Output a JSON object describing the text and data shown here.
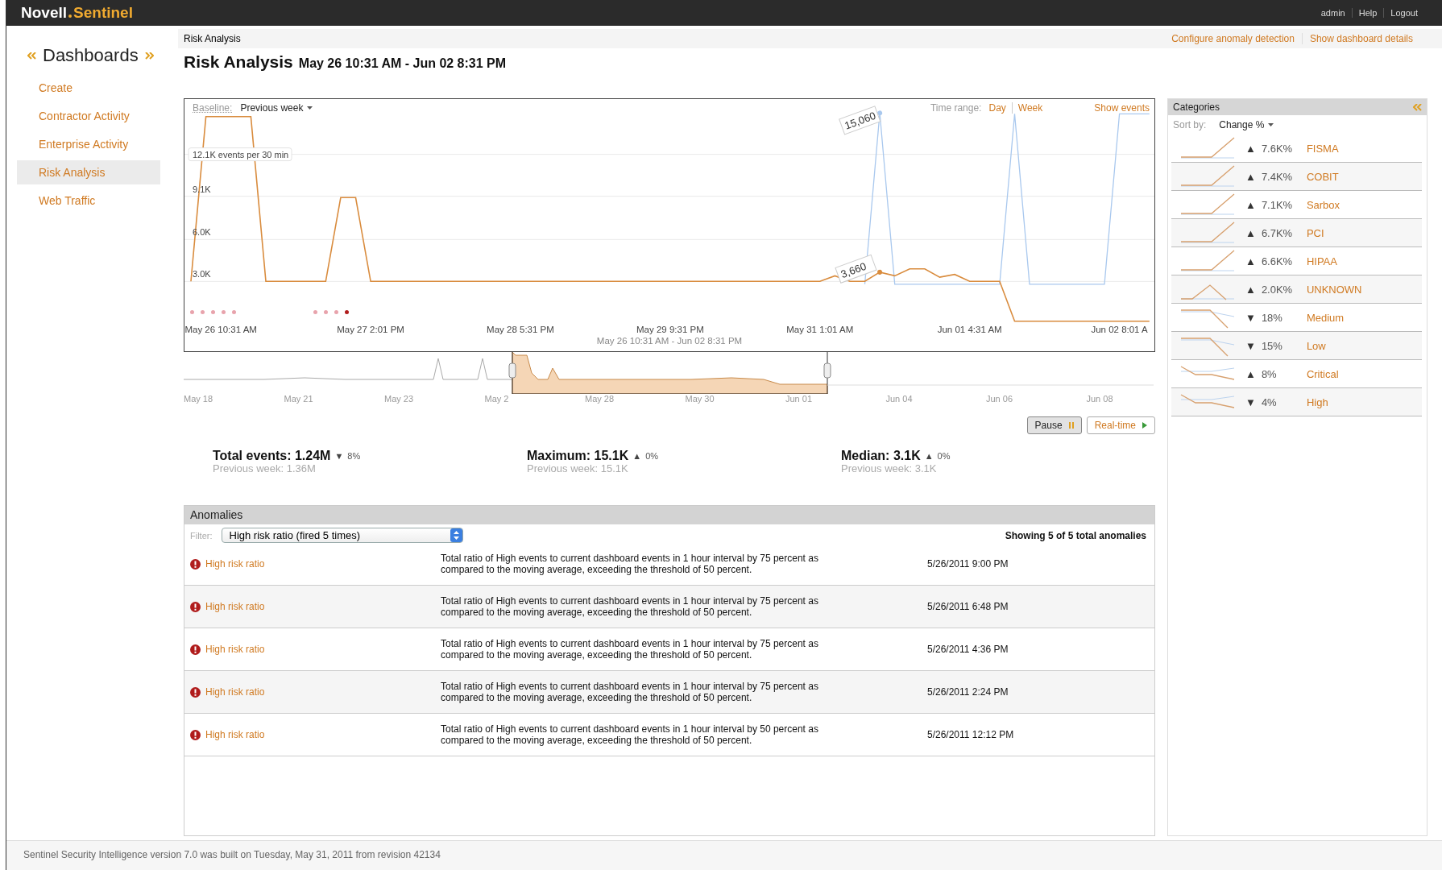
{
  "header": {
    "brand": "Novell",
    "product": "Sentinel",
    "links": [
      "admin",
      "Help",
      "Logout"
    ]
  },
  "sidebar": {
    "title": "Dashboards",
    "items": [
      {
        "label": "Create",
        "selected": false
      },
      {
        "label": "Contractor Activity",
        "selected": false
      },
      {
        "label": "Enterprise Activity",
        "selected": false
      },
      {
        "label": "Risk Analysis",
        "selected": true
      },
      {
        "label": "Web Traffic",
        "selected": false
      }
    ]
  },
  "breadcrumb": "Risk Analysis",
  "actions": [
    "Configure anomaly detection",
    "Show dashboard details"
  ],
  "page_title": {
    "title": "Risk Analysis",
    "range": "May 26 10:31 AM - Jun 02 8:31 PM"
  },
  "chart": {
    "baseline_label": "Baseline:",
    "baseline": "Previous week",
    "time_range_label": "Time range:",
    "time_ranges": [
      "Day",
      "Week"
    ],
    "show_events": "Show events",
    "chart_data": {
      "type": "line",
      "xlabel": "May 26 10:31 AM - Jun 02 8:31 PM",
      "categories": [
        null,
        null,
        "May 26 10:31 AM",
        null,
        null,
        null,
        null,
        null,
        null,
        null,
        null,
        null,
        "May 27 2:01 PM",
        null,
        null,
        null,
        null,
        null,
        null,
        null,
        null,
        null,
        "May 28 5:31 PM",
        null,
        null,
        null,
        null,
        null,
        null,
        null,
        null,
        null,
        "May 29 9:31 PM",
        null,
        null,
        null,
        null,
        null,
        null,
        null,
        null,
        null,
        "May 31 1:01 AM",
        null,
        null,
        null,
        null,
        null,
        null,
        null,
        null,
        null,
        "Jun 01 4:31 AM",
        null,
        null,
        null,
        null,
        null,
        null,
        null,
        null,
        null,
        "Jun 02 8:01 A",
        null,
        null
      ],
      "grid": true,
      "ylim": [
        -2000,
        16000
      ],
      "series": [
        {
          "color": "#a9c8ee",
          "values": [
            null,
            null,
            null,
            null,
            null,
            null,
            null,
            null,
            null,
            null,
            null,
            null,
            null,
            null,
            null,
            null,
            null,
            null,
            null,
            null,
            null,
            null,
            null,
            null,
            null,
            null,
            null,
            null,
            null,
            null,
            null,
            null,
            null,
            null,
            null,
            null,
            null,
            null,
            null,
            null,
            null,
            null,
            null,
            null,
            null,
            2800,
            15060,
            2800,
            2800,
            2800,
            2800,
            2800,
            2800,
            2800,
            2800,
            15000,
            2800,
            2800,
            2800,
            2800,
            2800,
            2800,
            15000,
            15000,
            15000
          ]
        },
        {
          "color": "#d98c3e",
          "values": [
            3000,
            14800,
            14800,
            14800,
            14800,
            3000,
            3000,
            3000,
            3000,
            3000,
            9000,
            9000,
            3000,
            3000,
            3000,
            3000,
            3000,
            3000,
            3000,
            3000,
            3000,
            3000,
            3000,
            3000,
            3000,
            3000,
            3000,
            3000,
            3000,
            3000,
            3000,
            3000,
            3000,
            3000,
            3000,
            3000,
            3000,
            3000,
            3000,
            3000,
            3000,
            3000,
            3000,
            3400,
            3000,
            3000,
            3660,
            3400,
            3900,
            3900,
            3300,
            3500,
            3000,
            3000,
            3000,
            150,
            150,
            150,
            150,
            150,
            150,
            150,
            150,
            150,
            150
          ]
        }
      ],
      "yticks": [
        {
          "value": 3000,
          "label": "3.0K"
        },
        {
          "value": 6000,
          "label": "6.0K"
        },
        {
          "value": 9100,
          "label": "9.1K"
        },
        {
          "value": 12100,
          "label": "12.1K events per 30 min"
        }
      ],
      "annotations": [
        "15,060",
        "3,660"
      ]
    },
    "event_marker_groups": [
      [
        {
          "color": "#e8a3ac"
        },
        {
          "color": "#e8a3ac"
        },
        {
          "color": "#e8a3ac"
        },
        {
          "color": "#e8a3ac"
        },
        {
          "color": "#e8a3ac"
        }
      ],
      [
        {
          "color": "#e8a3ac"
        },
        {
          "color": "#e8a3ac"
        },
        {
          "color": "#e8a3ac"
        },
        {
          "color": "#b01c1c"
        }
      ]
    ]
  },
  "navigator": {
    "labels": [
      "May 18",
      "May 21",
      "May 23",
      "May 2",
      "May 28",
      "May 30",
      "Jun 01",
      "Jun 04",
      "Jun 06",
      "Jun 08"
    ]
  },
  "playback": [
    {
      "label": "Pause",
      "kind": "pause",
      "selected": true
    },
    {
      "label": "Real-time",
      "kind": "play",
      "selected": false
    }
  ],
  "stats": [
    {
      "label": "Total events: 1.24M",
      "arrow": "▼",
      "change": "8%",
      "previous": "Previous week: 1.36M"
    },
    {
      "label": "Maximum: 15.1K",
      "arrow": "▲",
      "change": "0%",
      "previous": "Previous week: 15.1K"
    },
    {
      "label": "Median: 3.1K",
      "arrow": "▲",
      "change": "0%",
      "previous": "Previous week: 3.1K"
    }
  ],
  "anomalies": {
    "title": "Anomalies",
    "filter_label": "Filter:",
    "filter": "High risk ratio (fired 5 times)",
    "summary": "Showing 5 of 5 total anomalies",
    "rows": [
      {
        "name": "High risk ratio",
        "description": "Total ratio of High events to current dashboard events in 1 hour interval by 75 percent as compared to the moving average, exceeding the threshold of 50 percent.",
        "time": "5/26/2011 9:00 PM"
      },
      {
        "name": "High risk ratio",
        "description": "Total ratio of High events to current dashboard events in 1 hour interval by 75 percent as compared to the moving average, exceeding the threshold of 50 percent.",
        "time": "5/26/2011 6:48 PM"
      },
      {
        "name": "High risk ratio",
        "description": "Total ratio of High events to current dashboard events in 1 hour interval by 75 percent as compared to the moving average, exceeding the threshold of 50 percent.",
        "time": "5/26/2011 4:36 PM"
      },
      {
        "name": "High risk ratio",
        "description": "Total ratio of High events to current dashboard events in 1 hour interval by 75 percent as compared to the moving average, exceeding the threshold of 50 percent.",
        "time": "5/26/2011 2:24 PM"
      },
      {
        "name": "High risk ratio",
        "description": "Total ratio of High events to current dashboard events in 1 hour interval by 50 percent as compared to the moving average, exceeding the threshold of 50 percent.",
        "time": "5/26/2011 12:12 PM"
      }
    ]
  },
  "categories": {
    "title": "Categories",
    "sort_label": "Sort by:",
    "sort": "Change %",
    "items": [
      {
        "kind": "rise",
        "arrow": "▲",
        "change": "7.6K%",
        "name": "FISMA"
      },
      {
        "kind": "rise",
        "arrow": "▲",
        "change": "7.4K%",
        "name": "COBIT"
      },
      {
        "kind": "rise",
        "arrow": "▲",
        "change": "7.1K%",
        "name": "Sarbox"
      },
      {
        "kind": "rise",
        "arrow": "▲",
        "change": "6.7K%",
        "name": "PCI"
      },
      {
        "kind": "rise",
        "arrow": "▲",
        "change": "6.6K%",
        "name": "HIPAA"
      },
      {
        "kind": "peak",
        "arrow": "▲",
        "change": "2.0K%",
        "name": "UNKNOWN"
      },
      {
        "kind": "fall",
        "arrow": "▼",
        "change": "18%",
        "name": "Medium"
      },
      {
        "kind": "fall",
        "arrow": "▼",
        "change": "15%",
        "name": "Low"
      },
      {
        "kind": "dip",
        "arrow": "▲",
        "change": "8%",
        "name": "Critical"
      },
      {
        "kind": "dip",
        "arrow": "▼",
        "change": "4%",
        "name": "High"
      }
    ]
  },
  "footer": "Sentinel Security Intelligence version 7.0 was built on Tuesday, May 31, 2011 from revision 42134"
}
